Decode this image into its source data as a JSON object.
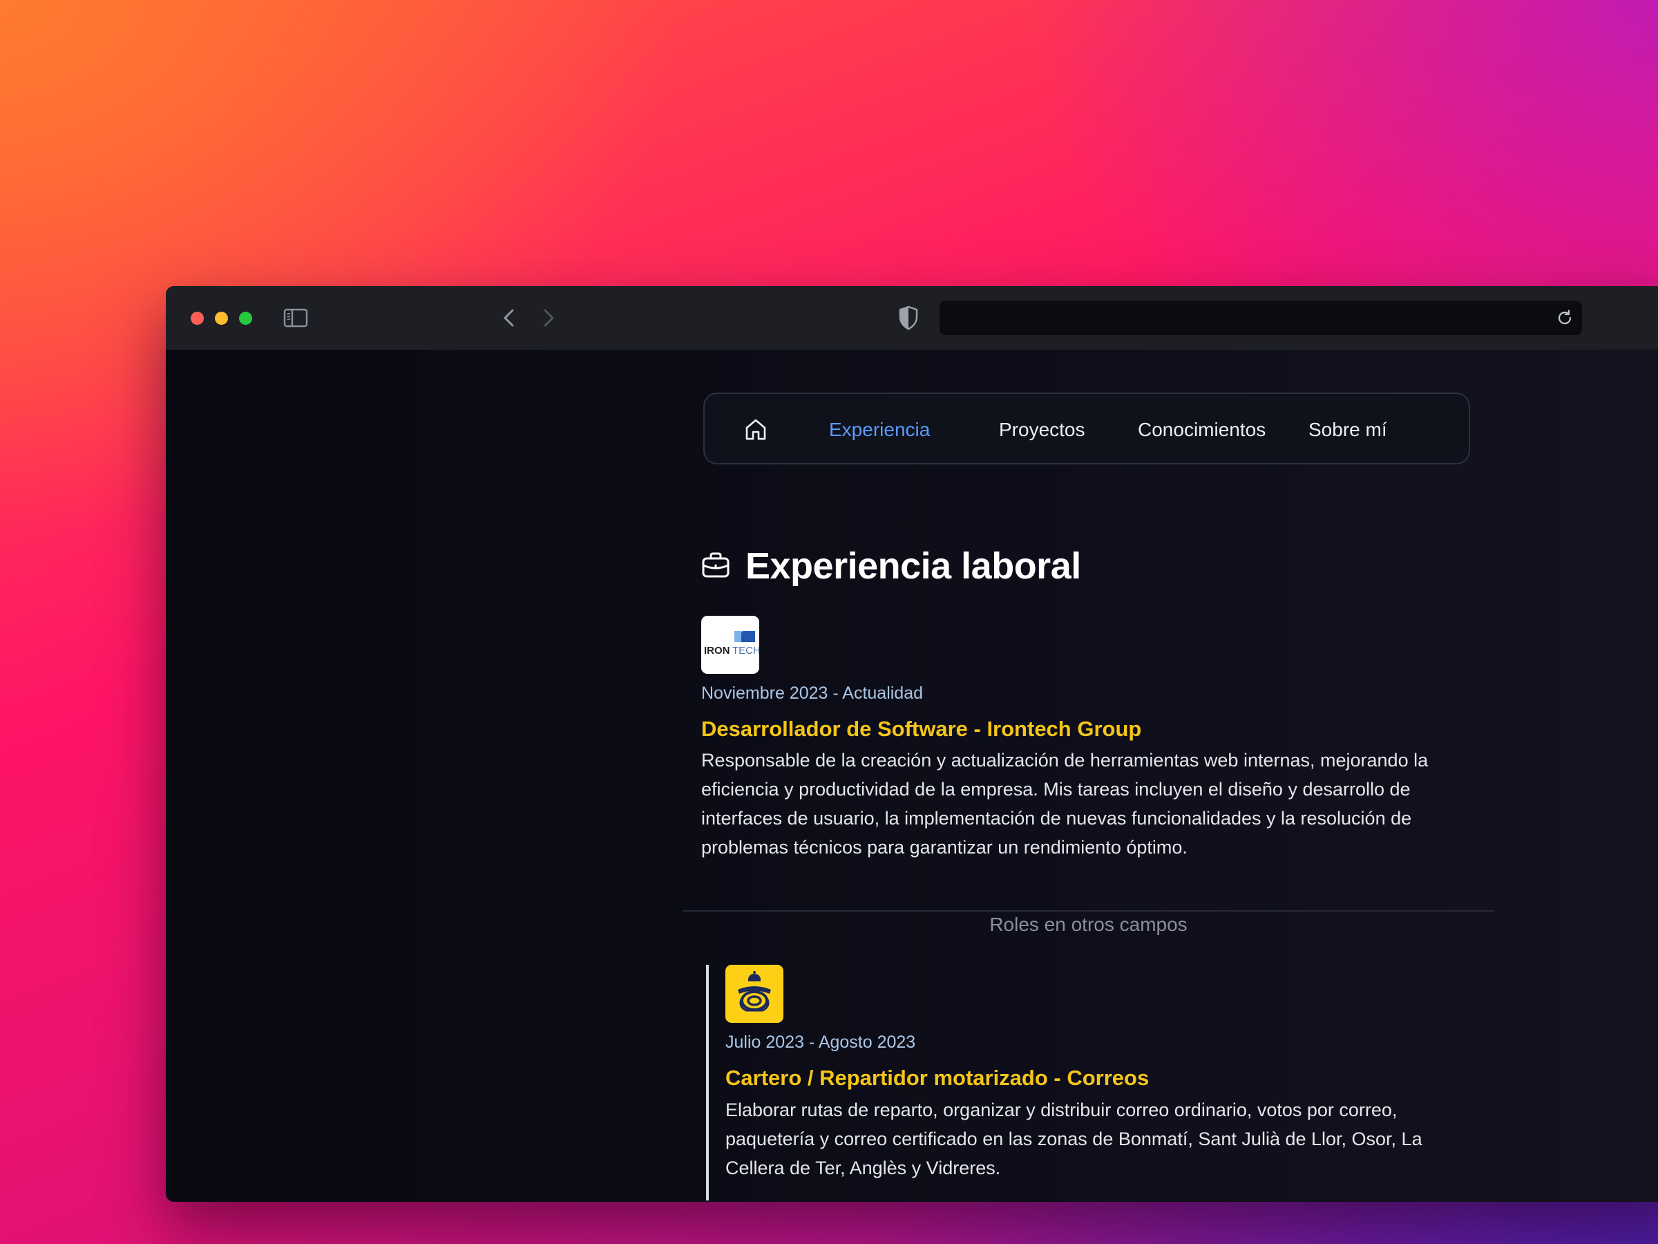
{
  "nav": {
    "items": [
      {
        "label": "Experiencia",
        "active": true
      },
      {
        "label": "Proyectos",
        "active": false
      },
      {
        "label": "Conocimientos",
        "active": false
      },
      {
        "label": "Sobre mí",
        "active": false
      }
    ]
  },
  "section": {
    "title": "Experiencia laboral",
    "icon": "briefcase-icon"
  },
  "experience": [
    {
      "logo_text": "IRONTECH",
      "dates": "Noviembre 2023 - Actualidad",
      "title": "Desarrollador de Software - Irontech Group",
      "description": "Responsable de la creación y actualización de herramientas web internas, mejorando la eficiencia y productividad de la empresa. Mis tareas incluyen el diseño y desarrollo de interfaces de usuario, la implementación de nuevas funcionalidades y la resolución de problemas técnicos para garantizar un rendimiento óptimo."
    }
  ],
  "other_roles": {
    "label": "Roles en otros campos",
    "items": [
      {
        "dates": "Julio 2023 - Agosto 2023",
        "title": "Cartero / Repartidor motarizado - Correos",
        "description": "Elaborar rutas de reparto, organizar y distribuir correo ordinario, votos por correo, paquetería y correo certificado en las zonas de Bonmatí, Sant Julià de Llor, Osor, La Cellera de Ter, Anglès y Vidreres."
      }
    ]
  },
  "colors": {
    "accent_link": "#5b9bff",
    "job_title": "#f5c518",
    "date": "#a9c6e4",
    "correos_brand": "#fdd016"
  }
}
